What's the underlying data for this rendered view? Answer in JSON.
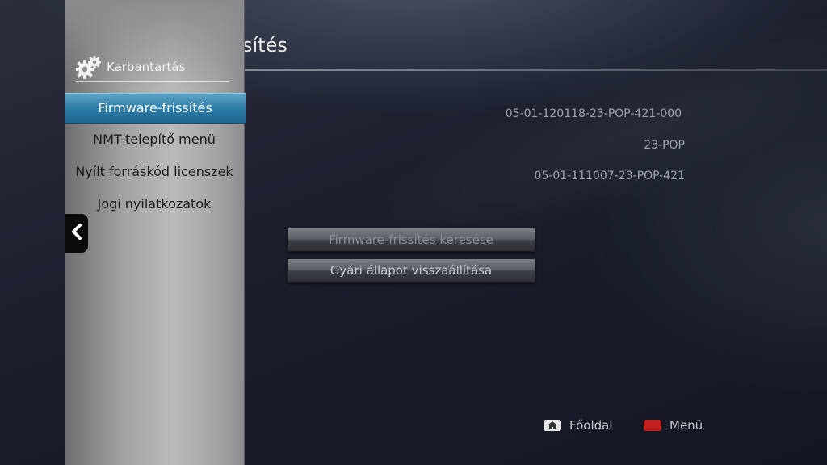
{
  "page": {
    "title": "Firmware-frissítés",
    "title_visible": "sítés"
  },
  "sidebar": {
    "header": "Karbantartás",
    "header_icon": "gears-icon",
    "items": [
      {
        "label": "Firmware-frissítés",
        "selected": true
      },
      {
        "label": "NMT-telepítő menü"
      },
      {
        "label": "Nyílt forráskód licenszek"
      },
      {
        "label": "Jogi nyilatkozatok"
      }
    ]
  },
  "info": {
    "line1": "05-01-120118-23-POP-421-000",
    "line2": "23-POP",
    "line3": "05-01-111007-23-POP-421"
  },
  "buttons": {
    "search_update": "Firmware-frissítés keresése",
    "factory_reset": "Gyári állapot visszaállítása"
  },
  "legend": {
    "home_label": "Főoldal",
    "menu_label": "Menü",
    "menu_key_color": "#c21f1f",
    "accent": "#2d7ea9"
  }
}
